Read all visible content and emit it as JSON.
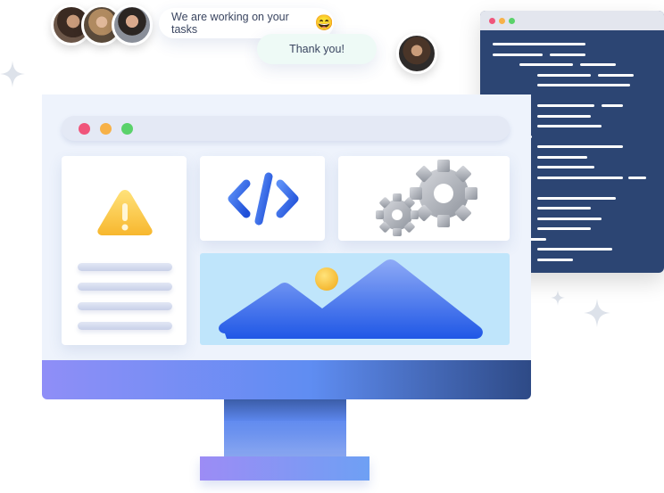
{
  "chat": {
    "message_1": "We are working on your tasks",
    "message_1_emoji": "😄",
    "message_2": "Thank you!"
  },
  "icons": {
    "warning": "warning-icon",
    "code": "code-icon",
    "settings": "gear-icon",
    "image": "image-icon"
  },
  "colors": {
    "code_window_bg": "#2c4573",
    "window_dot_red": "#f0557b",
    "window_dot_yellow": "#f7b148",
    "window_dot_green": "#5ad26a",
    "accent_blue": "#3b6ff0"
  }
}
